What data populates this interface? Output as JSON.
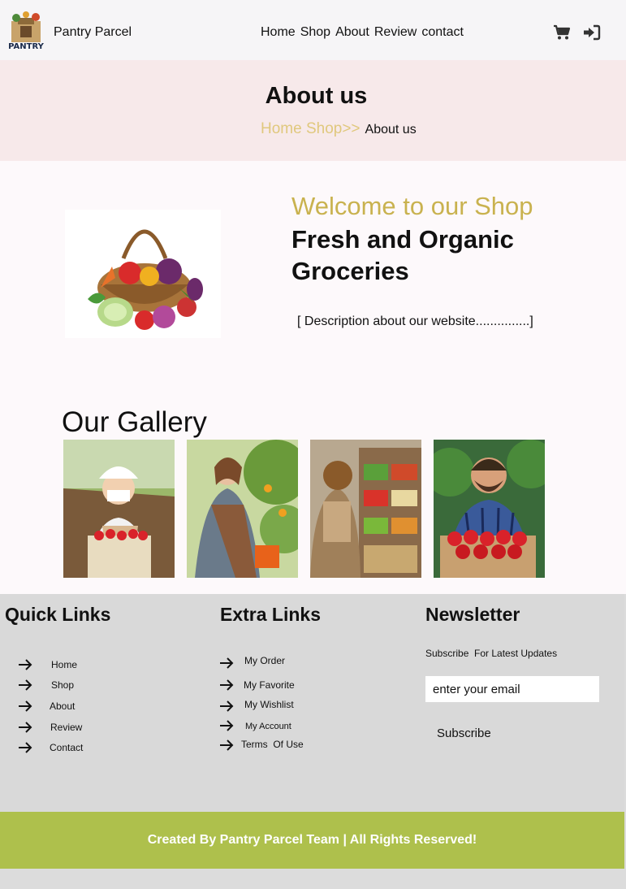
{
  "header": {
    "brand": "Pantry Parcel",
    "logo_text": "PANTRY",
    "nav": [
      "Home",
      "Shop",
      "About",
      "Review",
      "contact"
    ],
    "icons": [
      "cart-icon",
      "login-icon"
    ]
  },
  "hero": {
    "title": "About us",
    "crumb_link": "Home Shop>>",
    "crumb_current": "About us"
  },
  "intro": {
    "welcome": "Welcome to our Shop",
    "headline": "Fresh and Organic Groceries",
    "description": "[ Description about our website...............]"
  },
  "gallery": {
    "title": "Our Gallery",
    "photos": [
      "farmer-with-strawberries-photo",
      "gardener-picking-oranges-photo",
      "woman-at-produce-stand-photo",
      "man-with-tomato-crate-photo"
    ]
  },
  "footer": {
    "quick_links_title": "Quick Links",
    "quick_links": [
      "Home",
      "Shop",
      "About",
      "Review",
      "Contact"
    ],
    "extra_links_title": "Extra Links",
    "extra_links": [
      "My Order",
      "My Favorite",
      "My Wishlist",
      "My Account",
      "Terms  Of Use"
    ],
    "newsletter_title": "Newsletter",
    "newsletter_label": "Subscribe  For Latest Updates",
    "email_placeholder": "enter your email",
    "subscribe_label": "Subscribe",
    "copyright": "Created By Pantry Parcel Team | All Rights Reserved!"
  },
  "colors": {
    "accent_gold": "#c9b24f",
    "hero_bg": "#f7e9ea",
    "copyright_bg": "#aec04c"
  }
}
